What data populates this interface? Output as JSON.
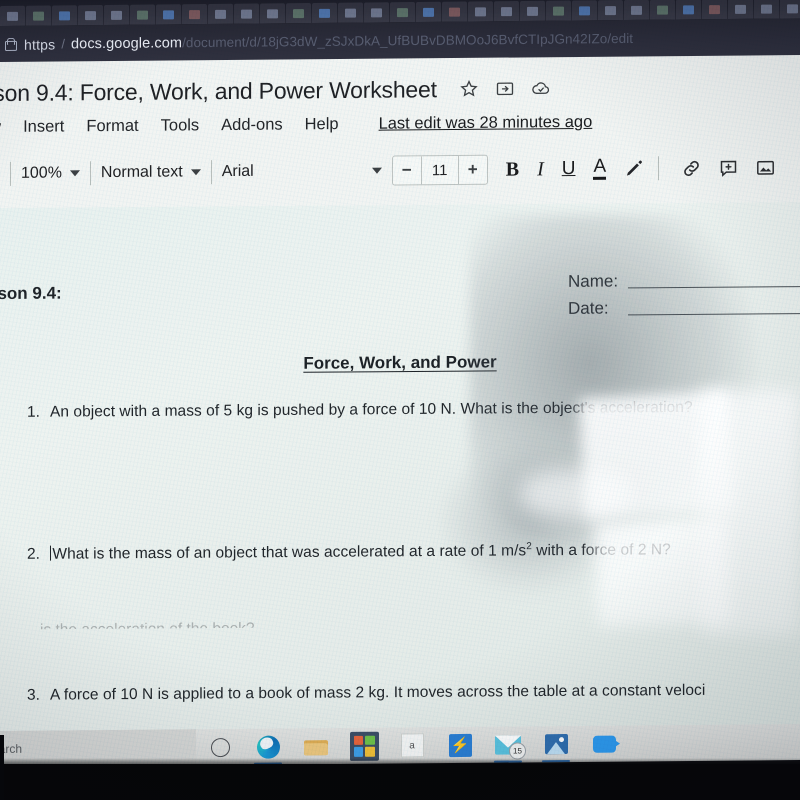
{
  "browser": {
    "tab_count": 32,
    "address_bar": {
      "lock_icon": "lock-icon",
      "scheme": "https",
      "separator": "/",
      "host": "docs.google.com",
      "path": "/document/d/18jG3dW_zSJxDkA_UfBUBvDBMOoJ6BvfCTIpJGn42IZo/edit"
    }
  },
  "docs": {
    "title": "sson 9.4: Force, Work, and Power Worksheet",
    "title_icons": [
      {
        "name": "star-icon",
        "label": "Star"
      },
      {
        "name": "move-to-folder-icon",
        "label": "Move to folder"
      },
      {
        "name": "cloud-saved-icon",
        "label": "Saved to Drive"
      }
    ],
    "menu": [
      "ew",
      "Insert",
      "Format",
      "Tools",
      "Add-ons",
      "Help"
    ],
    "last_edit": "Last edit was 28 minutes ago",
    "toolbar": {
      "zoom": "100%",
      "paragraph_style": "Normal text",
      "font": "Arial",
      "font_size_decrease": "−",
      "font_size": "11",
      "font_size_increase": "+",
      "bold": "B",
      "italic": "I",
      "underline": "U",
      "text_color": "A",
      "highlight": "highlight-pen-icon",
      "link": "link-icon",
      "comment": "add-comment-icon",
      "image": "insert-image-icon"
    }
  },
  "document": {
    "header_left": "sson 9.4:",
    "name_label": "Name:",
    "date_label": "Date:",
    "heading": "Force, Work, and Power",
    "questions": [
      {
        "number": "1.",
        "text": "An object with a mass of 5 kg is pushed by a force of 10 N. What is the object's acceleration?"
      },
      {
        "number": "2.",
        "text_before": "What is the mass of an object that was accelerated at a rate of 1 m/s",
        "superscript": "2",
        "text_after": " with a force of 2 N?",
        "has_cursor": true
      },
      {
        "number": "3.",
        "text": "A force of 10 N is applied to a book of mass 2 kg. It moves across the table at a constant veloci",
        "text_cut": "is the acceleration of the book?"
      }
    ]
  },
  "taskbar": {
    "search_placeholder": "earch",
    "items": [
      {
        "name": "cortana-icon",
        "label": "Cortana"
      },
      {
        "name": "edge-icon",
        "label": "Microsoft Edge",
        "active": true
      },
      {
        "name": "file-explorer-icon",
        "label": "File Explorer"
      },
      {
        "name": "microsoft-store-icon",
        "label": "Microsoft Store"
      },
      {
        "name": "document-icon",
        "label": "a"
      },
      {
        "name": "lightning-app-icon",
        "label": "App"
      },
      {
        "name": "mail-icon",
        "label": "Mail",
        "badge": "15",
        "active": true
      },
      {
        "name": "photos-icon",
        "label": "Photos",
        "active": true
      },
      {
        "name": "zoom-icon",
        "label": "Zoom"
      }
    ]
  },
  "colors": {
    "accent": "#3a7ec4",
    "docs_chrome": "#f2f4f2",
    "page": "#e9f1ef",
    "taskbar": "#e2e3e1",
    "url_bar": "#2b2c3a"
  }
}
